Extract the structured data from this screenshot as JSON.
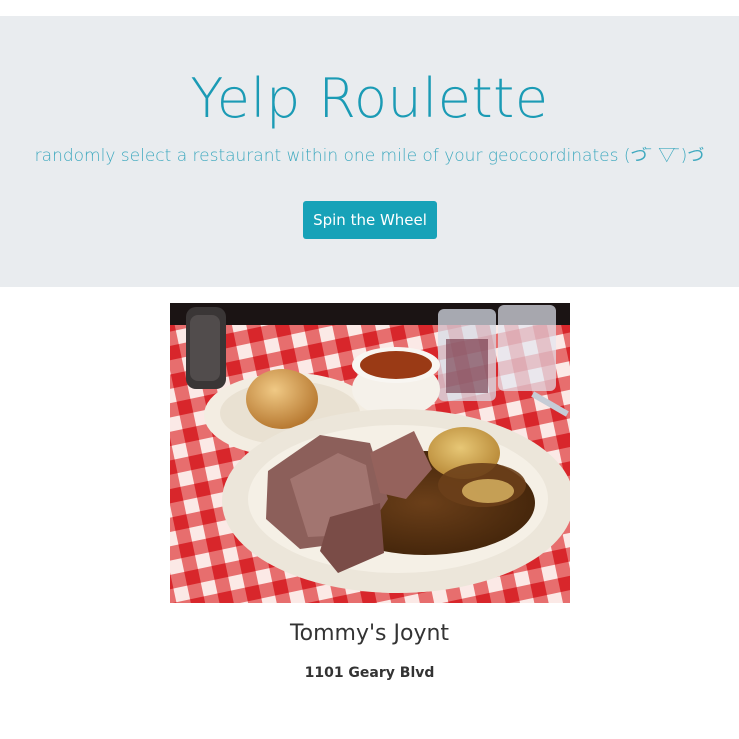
{
  "header": {
    "title": "Yelp Roulette",
    "subtitle": "randomly select a restaurant within one mile of your geocoordinates (づ ̄ ▽ ̄)づ",
    "spin_button_label": "Spin the Wheel"
  },
  "result": {
    "photo_alt": "Tommy's Joynt",
    "name": "Tommy's Joynt",
    "address": "1101 Geary Blvd"
  },
  "colors": {
    "accent": "#17a2b8",
    "hero_background": "#e9ecef",
    "text_dark": "#333333"
  }
}
